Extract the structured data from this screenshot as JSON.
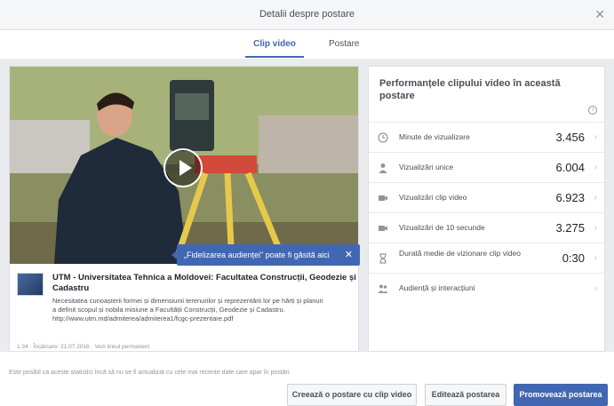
{
  "header": {
    "title": "Detalii despre postare"
  },
  "tabs": [
    {
      "label": "Clip video",
      "active": true
    },
    {
      "label": "Postare",
      "active": false
    }
  ],
  "video": {
    "tooltip": "„Fidelizarea audienței\" poate fi găsită aici"
  },
  "page": {
    "name": "UTM - Universitatea Tehnica a Moldovei: Facultatea Construcții, Geodezie și Cadastru",
    "description_lines": [
      "Necesitatea cunoașterii formei și dimensiunii terenurilor și reprezentării lor pe hărți și planuri",
      "a definit scopul și nobila misiune a Facultății Construcții, Geodezie și Cadastru.",
      "http://www.utm.md/admiterea/admiterea1/fcgc-prezentare.pdf"
    ],
    "meta": "1:34 · Încărcare: 21.07.2016 · Vezi linkul permanent"
  },
  "performance": {
    "title": "Performanțele clipului video în această postare",
    "metrics": [
      {
        "icon": "clock-icon",
        "label": "Minute de vizualizare",
        "value": "3.456"
      },
      {
        "icon": "person-icon",
        "label": "Vizualizări unice",
        "value": "6.004"
      },
      {
        "icon": "video-icon",
        "label": "Vizualizări clip video",
        "value": "6.923"
      },
      {
        "icon": "video-icon",
        "label": "Vizualizări de 10 secunde",
        "value": "3.275"
      },
      {
        "icon": "hourglass-icon",
        "label": "Durată medie de vizionare clip video",
        "value": "0:30"
      },
      {
        "icon": "people-icon",
        "label": "Audiență și interacțiuni",
        "value": ""
      }
    ]
  },
  "footer": {
    "note": "Este posibil ca aceste statistici încă să nu se fi actualizat cu cele mai recente date care apar în postări.",
    "buttons": {
      "create": "Creează o postare cu clip video",
      "edit": "Editează postarea",
      "promote": "Promovează postarea"
    }
  },
  "colors": {
    "accent": "#4267b2",
    "background": "#e9ebee"
  }
}
